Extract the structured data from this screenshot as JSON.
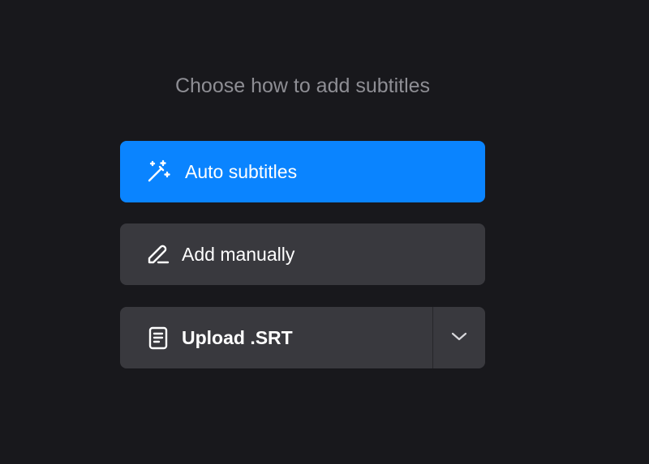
{
  "heading": "Choose how to add subtitles",
  "options": {
    "auto": {
      "label": "Auto subtitles",
      "icon": "magic-wand-icon"
    },
    "manual": {
      "label": "Add manually",
      "icon": "pencil-icon"
    },
    "upload": {
      "label": "Upload .SRT",
      "icon": "document-icon",
      "toggle_icon": "chevron-down-icon"
    }
  },
  "colors": {
    "background": "#18181c",
    "primary": "#0a84ff",
    "secondary": "#39393e",
    "heading_text": "#8e8e94",
    "button_text": "#ffffff"
  }
}
